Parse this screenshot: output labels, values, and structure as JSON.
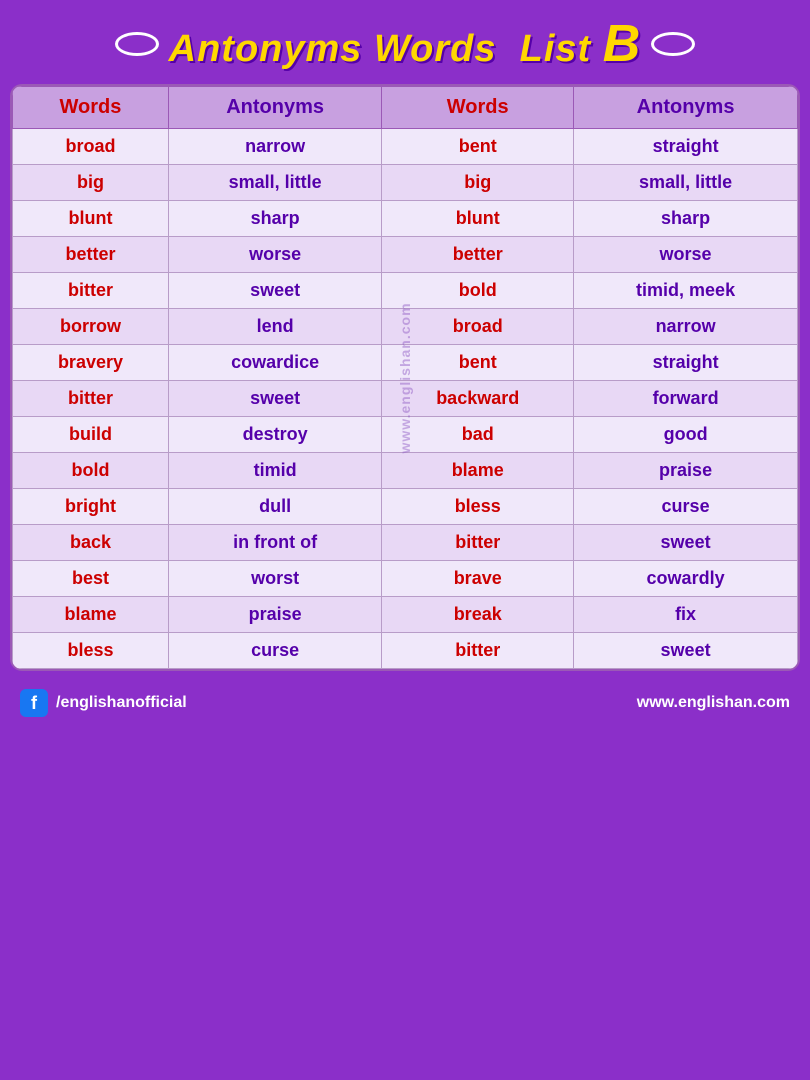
{
  "title": {
    "text": "Antonyms Words  List",
    "letter": "B",
    "oval_count": 2
  },
  "table": {
    "headers": [
      {
        "label": "Words",
        "type": "red"
      },
      {
        "label": "Antonyms",
        "type": "normal"
      },
      {
        "label": "Words",
        "type": "red"
      },
      {
        "label": "Antonyms",
        "type": "normal"
      }
    ],
    "rows": [
      {
        "w1": "broad",
        "a1": "narrow",
        "w2": "bent",
        "a2": "straight"
      },
      {
        "w1": "big",
        "a1": "small, little",
        "w2": "big",
        "a2": "small, little"
      },
      {
        "w1": "blunt",
        "a1": "sharp",
        "w2": "blunt",
        "a2": "sharp"
      },
      {
        "w1": "better",
        "a1": "worse",
        "w2": "better",
        "a2": "worse"
      },
      {
        "w1": "bitter",
        "a1": "sweet",
        "w2": "bold",
        "a2": "timid, meek"
      },
      {
        "w1": "borrow",
        "a1": "lend",
        "w2": "broad",
        "a2": "narrow"
      },
      {
        "w1": "bravery",
        "a1": "cowardice",
        "w2": "bent",
        "a2": "straight"
      },
      {
        "w1": "bitter",
        "a1": "sweet",
        "w2": "backward",
        "a2": "forward"
      },
      {
        "w1": "build",
        "a1": "destroy",
        "w2": "bad",
        "a2": "good"
      },
      {
        "w1": "bold",
        "a1": "timid",
        "w2": "blame",
        "a2": "praise"
      },
      {
        "w1": "bright",
        "a1": "dull",
        "w2": "bless",
        "a2": "curse"
      },
      {
        "w1": "back",
        "a1": "in front of",
        "w2": "bitter",
        "a2": "sweet"
      },
      {
        "w1": "best",
        "a1": "worst",
        "w2": "brave",
        "a2": "cowardly"
      },
      {
        "w1": "blame",
        "a1": "praise",
        "w2": "break",
        "a2": "fix"
      },
      {
        "w1": "bless",
        "a1": "curse",
        "w2": "bitter",
        "a2": "sweet"
      }
    ]
  },
  "watermark": "www.englishan.com",
  "footer": {
    "fb_handle": "/englishanofficial",
    "website": "www.englishan.com"
  }
}
